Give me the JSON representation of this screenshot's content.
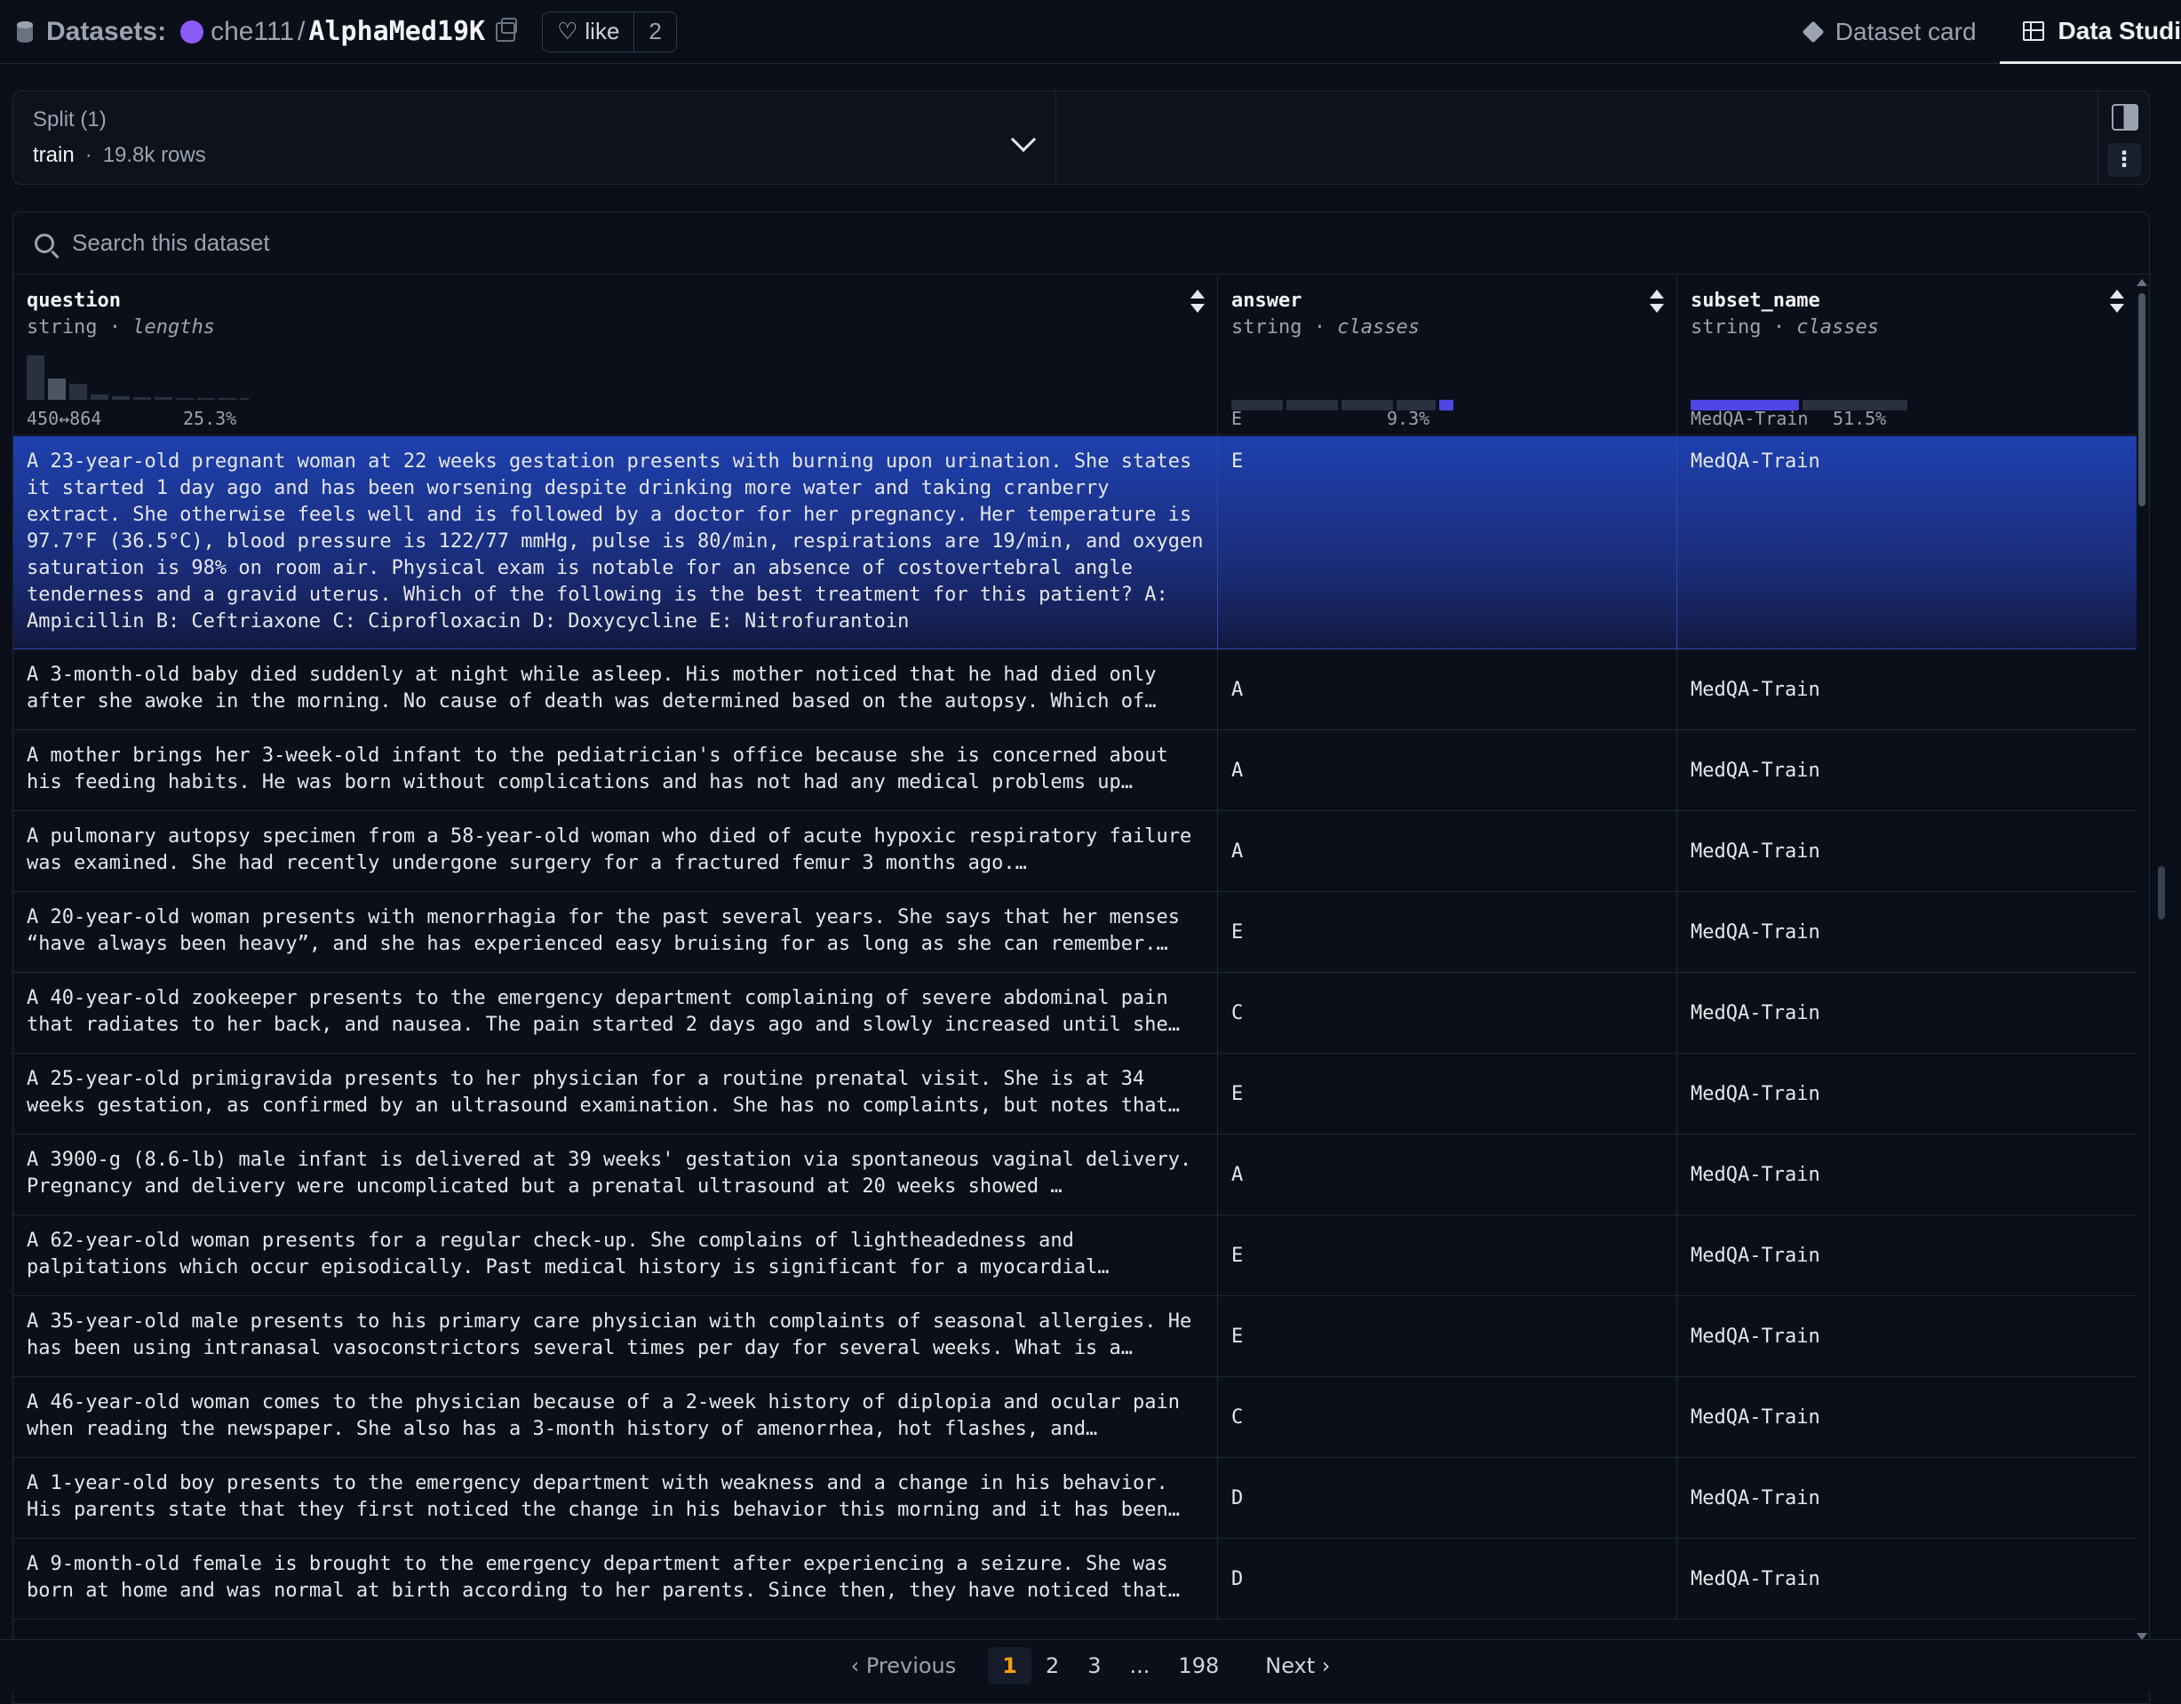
{
  "header": {
    "section_label": "Datasets:",
    "owner": "che111",
    "separator": "/",
    "repo": "AlphaMed19K",
    "like_label": "like",
    "like_count": "2",
    "tabs": [
      {
        "label": "Dataset card",
        "icon": "cube-icon",
        "active": false
      },
      {
        "label": "Data Studi",
        "icon": "table-grid-icon",
        "active": true
      }
    ]
  },
  "split": {
    "title": "Split (1)",
    "name": "train",
    "dot": "·",
    "rows": "19.8k rows"
  },
  "search": {
    "placeholder": "Search this dataset"
  },
  "columns": [
    {
      "name": "question",
      "type": "string",
      "kind": "lengths",
      "stat_left": "450↔864",
      "stat_right": "25.3%"
    },
    {
      "name": "answer",
      "type": "string",
      "kind": "classes",
      "stat_left": "E",
      "stat_right": "9.3%"
    },
    {
      "name": "subset_name",
      "type": "string",
      "kind": "classes",
      "stat_left": "MedQA-Train",
      "stat_right": "51.5%"
    }
  ],
  "type_sep": " · ",
  "rows": [
    {
      "question": "A 23-year-old pregnant woman at 22 weeks gestation presents with burning upon urination. She states it started 1 day ago and has been worsening despite drinking more water and taking cranberry extract. She otherwise feels well and is followed by a doctor for her pregnancy. Her temperature is 97.7°F (36.5°C), blood pressure is 122/77 mmHg, pulse is 80/min, respirations are 19/min, and oxygen saturation is 98% on room air. Physical exam is notable for an absence of costovertebral angle tenderness and a gravid uterus. Which of the following is the best treatment for this patient? A: Ampicillin B: Ceftriaxone C: Ciprofloxacin D: Doxycycline E: Nitrofurantoin",
      "answer": "E",
      "subset": "MedQA-Train"
    },
    {
      "question": "A 3-month-old baby died suddenly at night while asleep. His mother noticed that he had died only after she awoke in the morning. No cause of death was determined based on the autopsy. Which of…",
      "answer": "A",
      "subset": "MedQA-Train"
    },
    {
      "question": "A mother brings her 3-week-old infant to the pediatrician's office because she is concerned about his feeding habits. He was born without complications and has not had any medical problems up…",
      "answer": "A",
      "subset": "MedQA-Train"
    },
    {
      "question": "A pulmonary autopsy specimen from a 58-year-old woman who died of acute hypoxic respiratory failure was examined. She had recently undergone surgery for a fractured femur 3 months ago.…",
      "answer": "A",
      "subset": "MedQA-Train"
    },
    {
      "question": "A 20-year-old woman presents with menorrhagia for the past several years. She says that her menses “have always been heavy”, and she has experienced easy bruising for as long as she can remember.…",
      "answer": "E",
      "subset": "MedQA-Train"
    },
    {
      "question": "A 40-year-old zookeeper presents to the emergency department complaining of severe abdominal pain that radiates to her back, and nausea. The pain started 2 days ago and slowly increased until she…",
      "answer": "C",
      "subset": "MedQA-Train"
    },
    {
      "question": "A 25-year-old primigravida presents to her physician for a routine prenatal visit. She is at 34 weeks gestation, as confirmed by an ultrasound examination. She has no complaints, but notes that…",
      "answer": "E",
      "subset": "MedQA-Train"
    },
    {
      "question": "A 3900-g (8.6-lb) male infant is delivered at 39 weeks' gestation via spontaneous vaginal delivery. Pregnancy and delivery were uncomplicated but a prenatal ultrasound at 20 weeks showed …",
      "answer": "A",
      "subset": "MedQA-Train"
    },
    {
      "question": "A 62-year-old woman presents for a regular check-up. She complains of lightheadedness and palpitations which occur episodically. Past medical history is significant for a myocardial…",
      "answer": "E",
      "subset": "MedQA-Train"
    },
    {
      "question": "A 35-year-old male presents to his primary care physician with complaints of seasonal allergies. He has been using intranasal vasoconstrictors several times per day for several weeks. What is a…",
      "answer": "E",
      "subset": "MedQA-Train"
    },
    {
      "question": "A 46-year-old woman comes to the physician because of a 2-week history of diplopia and ocular pain when reading the newspaper. She also has a 3-month history of amenorrhea, hot flashes, and…",
      "answer": "C",
      "subset": "MedQA-Train"
    },
    {
      "question": "A 1-year-old boy presents to the emergency department with weakness and a change in his behavior. His parents state that they first noticed the change in his behavior this morning and it has been…",
      "answer": "D",
      "subset": "MedQA-Train"
    },
    {
      "question": "A 9-month-old female is brought to the emergency department after experiencing a seizure. She was born at home and was normal at birth according to her parents. Since then, they have noticed that…",
      "answer": "D",
      "subset": "MedQA-Train"
    }
  ],
  "pagination": {
    "prev_label": "Previous",
    "pages": [
      "1",
      "2",
      "3",
      "...",
      "198"
    ],
    "current": "1",
    "next_label": "Next"
  },
  "colors": {
    "background": "#0b0f19",
    "selected_row": "#1e40af",
    "accent": "#4f46e5",
    "active_page": "#f59e0b"
  }
}
